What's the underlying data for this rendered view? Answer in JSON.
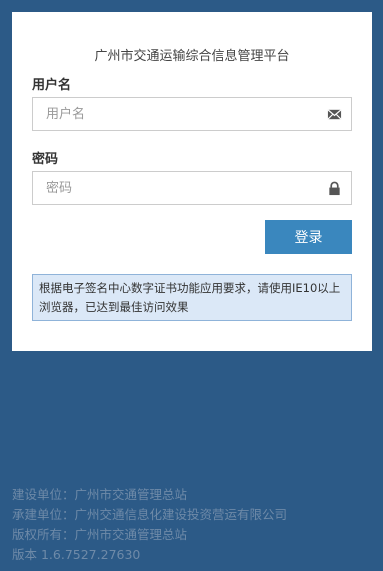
{
  "login": {
    "title": "广州市交通运输综合信息管理平台",
    "username": {
      "label": "用户名",
      "placeholder": "用户名",
      "value": ""
    },
    "password": {
      "label": "密码",
      "placeholder": "密码",
      "value": ""
    },
    "submit_label": "登录",
    "notice": "根据电子签名中心数字证书功能应用要求，请使用IE10以上浏览器，已达到最佳访问效果"
  },
  "footer": {
    "builder": "建设单位：广州市交通管理总站",
    "contractor": "承建单位：广州交通信息化建设投资营运有限公司",
    "copyright": "版权所有：广州市交通管理总站",
    "version": "版本 1.6.7527.27630"
  },
  "icons": {
    "username": "envelope-icon",
    "password": "lock-icon"
  },
  "colors": {
    "background": "#2c5a87",
    "button": "#3a87be",
    "notice_bg": "#dbe8f7",
    "notice_border": "#8fb3d9",
    "footer_text": "#6e8aa8"
  }
}
